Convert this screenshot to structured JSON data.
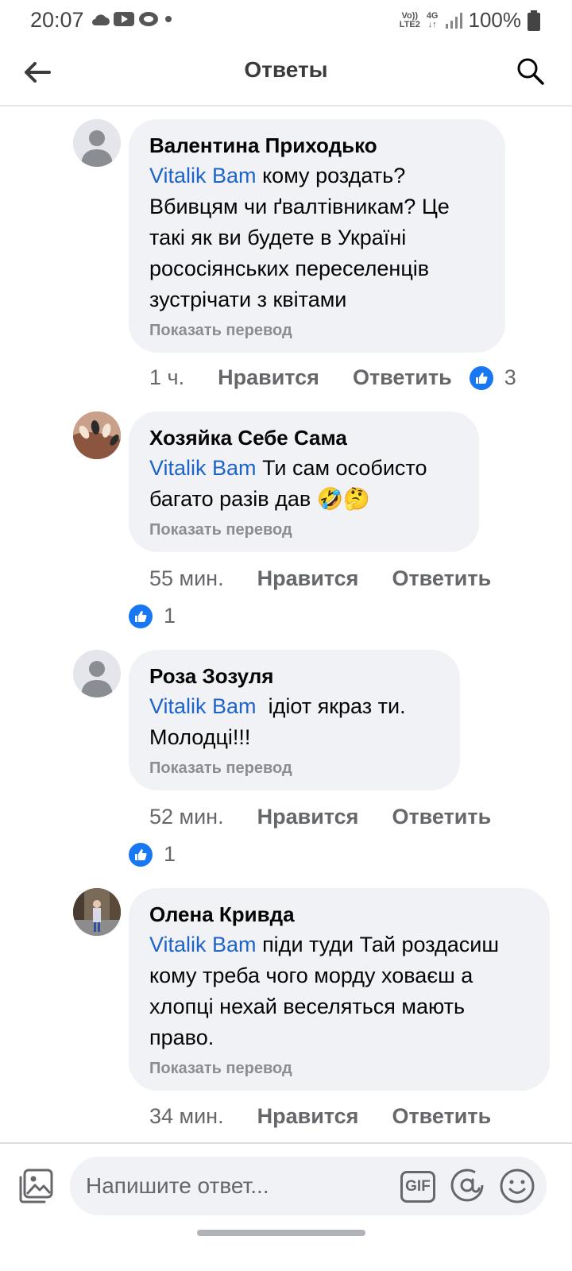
{
  "status_bar": {
    "time": "20:07",
    "network_top": "Vo))",
    "network_bottom": "LTE2",
    "signal_top": "4G",
    "battery": "100%"
  },
  "header": {
    "title": "Ответы",
    "back_icon": "arrow-left-icon",
    "search_icon": "search-icon"
  },
  "comments": [
    {
      "author": "Валентина Приходько",
      "mention": "Vitalik Bam",
      "text": " кому роздать? Вбивцям чи ґвалтівникам? Це такі як ви будете в Україні рососіянських переселенців зустрічати з квітами",
      "translate": "Показать перевод",
      "time": "1 ч.",
      "like_label": "Нравится",
      "reply_label": "Ответить",
      "reactions": "3"
    },
    {
      "author": "Хозяйка Себе Сама",
      "mention": "Vitalik Bam",
      "text": " Ти сам особисто багато разів дав 🤣🤔",
      "translate": "Показать перевод",
      "time": "55 мин.",
      "like_label": "Нравится",
      "reply_label": "Ответить",
      "reactions": "1"
    },
    {
      "author": "Роза Зозуля",
      "mention": "Vitalik Bam",
      "text": "  ідіот якраз ти. Молодці!!!",
      "translate": "Показать перевод",
      "time": "52 мин.",
      "like_label": "Нравится",
      "reply_label": "Ответить",
      "reactions": "1"
    },
    {
      "author": "Олена Кривда",
      "mention": "Vitalik Bam",
      "text": " піди туди Тай роздасиш кому треба чого морду ховаєш а хлопці нехай веселяться мають право.",
      "translate": "Показать перевод",
      "time": "34 мин.",
      "like_label": "Нравится",
      "reply_label": "Ответить"
    }
  ],
  "composer": {
    "placeholder": "Напишите ответ...",
    "gif_label": "GIF"
  },
  "colors": {
    "mention": "#1e64c8",
    "like_badge": "#1877f2",
    "bubble": "#f0f2f5",
    "secondary_text": "#65676b"
  }
}
